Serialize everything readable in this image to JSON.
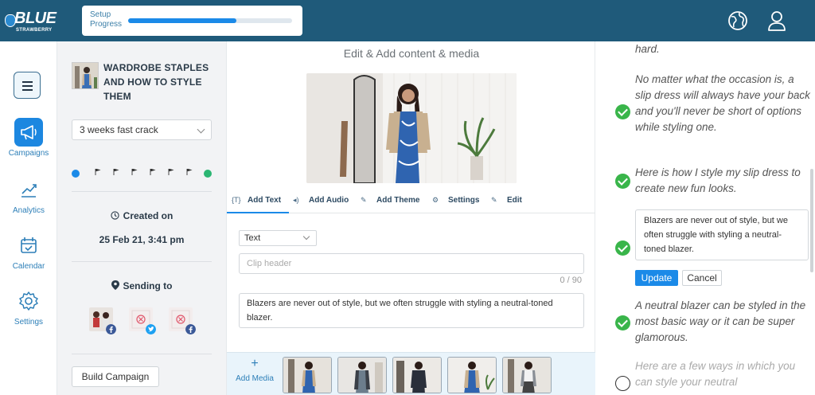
{
  "header": {
    "brand_main": "BLUE",
    "brand_sub": "STRAWBERRY",
    "setup_label": "Setup Progress",
    "setup_progress": 0.66,
    "icons": [
      "globe-icon",
      "user-icon"
    ]
  },
  "nav": {
    "items": [
      {
        "label": "Campaigns",
        "icon": "megaphone-icon",
        "active": true
      },
      {
        "label": "Analytics",
        "icon": "trend-icon",
        "active": false
      },
      {
        "label": "Calendar",
        "icon": "calendar-icon",
        "active": false
      },
      {
        "label": "Settings",
        "icon": "gear-icon",
        "active": false
      }
    ]
  },
  "campaign": {
    "title": "WARDROBE STAPLES AND HOW TO STYLE THEM",
    "schedule": "3 weeks fast crack",
    "created_label": "Created on",
    "created_date": "25 Feb 21, 3:41 pm",
    "sending_label": "Sending to",
    "build_label": "Build Campaign"
  },
  "editor": {
    "title": "Edit & Add content & media",
    "tabs": [
      "Add Text",
      "Add Audio",
      "Add Theme",
      "Settings",
      "Edit"
    ],
    "type_value": "Text",
    "clip_placeholder": "Clip header",
    "counter": "0 / 90",
    "body_text": "Blazers are never out of style, but we often struggle with styling a neutral-toned blazer.",
    "add_media_label": "Add Media"
  },
  "script": {
    "para_top": "hard.",
    "para1": "No matter what the occasion is, a slip dress will always have your back and you'll never be short of options while styling one.",
    "para2": "Here is how I style my slip dress to create new fun looks.",
    "edit_text": "Blazers are never out of style, but we often struggle with styling a neutral-toned blazer.",
    "update_label": "Update",
    "cancel_label": "Cancel",
    "para3": "A neutral blazer can be styled in the most basic way or it can be super glamorous.",
    "para4": "Here are a few ways in which you can style your neutral"
  },
  "colors": {
    "header": "#1f5a7a",
    "accent": "#1b8ae8",
    "check": "#39b54a",
    "facebook": "#3b5998",
    "twitter": "#1da1f2"
  }
}
